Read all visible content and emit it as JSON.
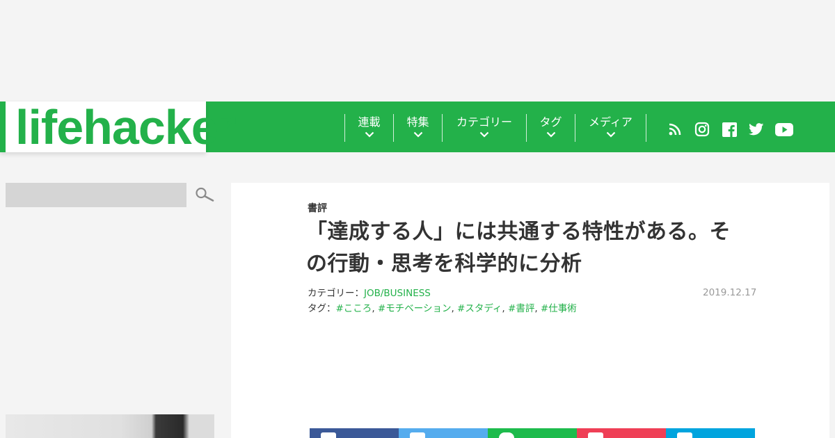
{
  "header": {
    "logo_text": "lifehacker",
    "brand_color": "#23b14a",
    "nav": [
      {
        "label": "連載"
      },
      {
        "label": "特集"
      },
      {
        "label": "カテゴリー"
      },
      {
        "label": "タグ"
      },
      {
        "label": "メディア"
      }
    ],
    "social_icons": [
      "rss-icon",
      "instagram-icon",
      "facebook-icon",
      "twitter-icon",
      "youtube-icon"
    ]
  },
  "sidebar": {
    "search_icon": "search-icon"
  },
  "article": {
    "category_label": "書評",
    "title": "「達成する人」には共通する特性がある。その行動・思考を科学的に分析",
    "category_prefix": "カテゴリー：",
    "category": "JOB/BUSINESS",
    "tags_prefix": "タグ：",
    "tags": [
      "#こころ",
      "#モチベーション",
      "#スタディ",
      "#書評",
      "#仕事術"
    ],
    "tag_separator": ", ",
    "date": "2019.12.17"
  },
  "share": {
    "buttons": [
      {
        "name": "facebook",
        "color": "#3b5998"
      },
      {
        "name": "twitter",
        "color": "#55acee"
      },
      {
        "name": "line",
        "color": "#1dbb4c"
      },
      {
        "name": "pocket",
        "color": "#ef3f56"
      },
      {
        "name": "hatena",
        "color": "#00a4de"
      }
    ]
  }
}
